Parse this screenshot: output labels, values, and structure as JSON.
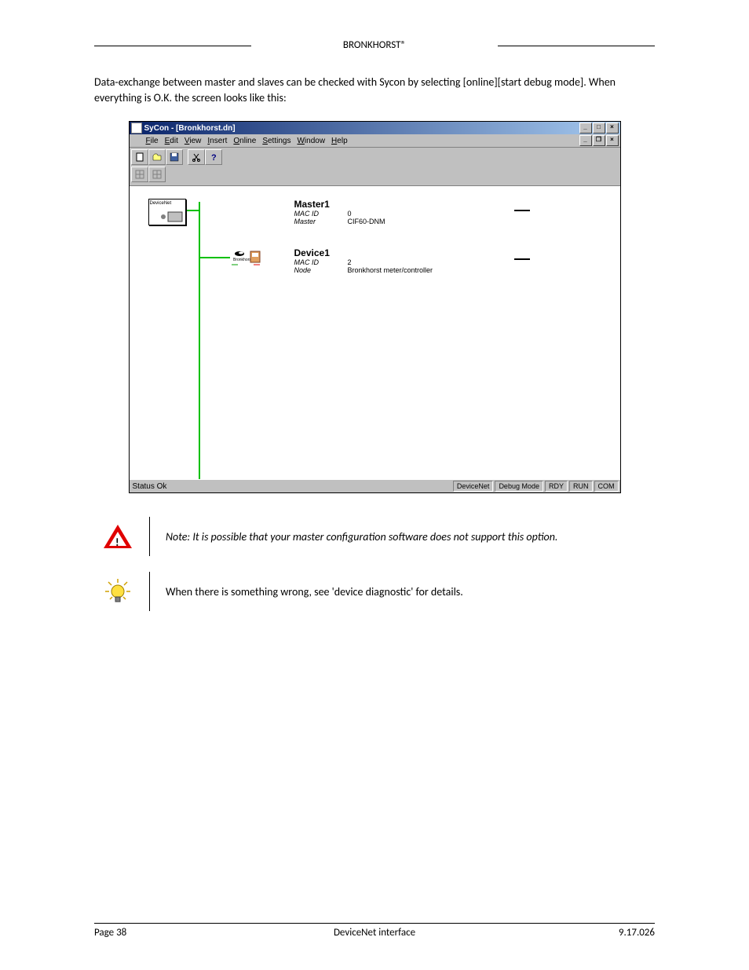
{
  "header": {
    "brand": "BRONKHORST®"
  },
  "intro": "Data-exchange between master and slaves can be checked with Sycon by selecting [online][start debug mode]. When everything is O.K. the screen looks like this:",
  "app": {
    "title": "SyCon - [Bronkhorst.dn]",
    "menus": {
      "file": "File",
      "edit": "Edit",
      "view": "View",
      "insert": "Insert",
      "online": "Online",
      "settings": "Settings",
      "window": "Window",
      "help": "Help"
    },
    "master_box_label": "DeviceNet",
    "master": {
      "name": "Master1",
      "row1_label": "MAC ID",
      "row1_val": "0",
      "row2_label": "Master",
      "row2_val": "CIF60-DNM"
    },
    "device": {
      "name": "Device1",
      "row1_label": "MAC ID",
      "row1_val": "2",
      "row2_label": "Node",
      "row2_val": "Bronkhorst meter/controller",
      "icon_text": "Bronkhorst"
    },
    "status": {
      "left": "Status Ok",
      "cells": [
        "DeviceNet",
        "Debug Mode",
        "RDY",
        "RUN",
        "COM"
      ]
    }
  },
  "note1": "Note: It is possible that your master configuration software does not support this option.",
  "note2": "When there is something wrong, see 'device diagnostic' for details.",
  "footer": {
    "left": "Page 38",
    "center": "DeviceNet interface",
    "right": "9.17.026"
  }
}
